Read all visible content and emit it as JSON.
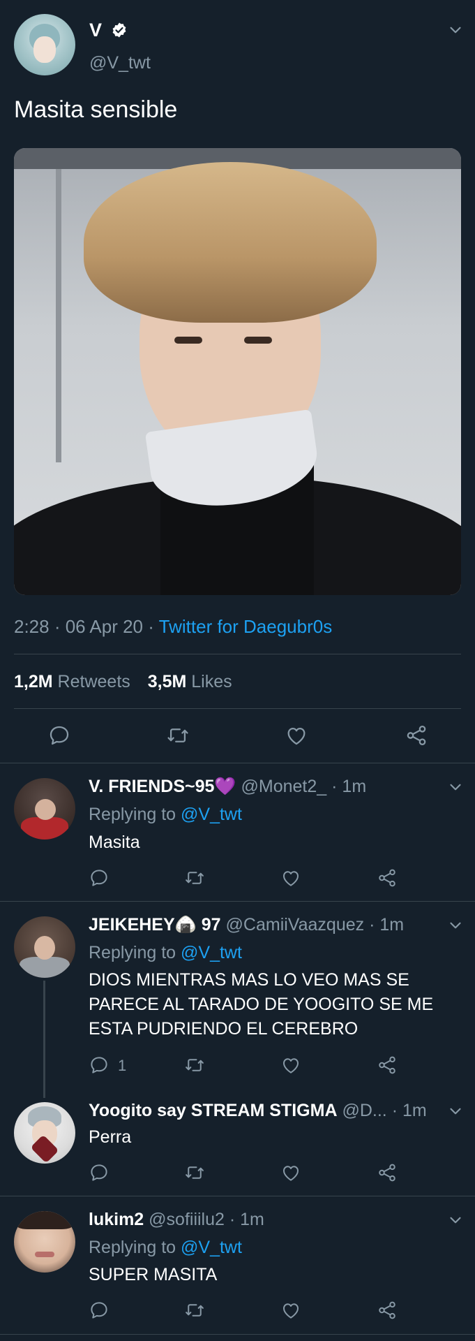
{
  "tweet": {
    "author_name": "V",
    "author_handle": "@V_twt",
    "text": "Masita sensible",
    "time": "2:28 · 06 Apr 20 · ",
    "source": "Twitter for Daegubr0s",
    "retweets_count": "1,2M",
    "retweets_label": "Retweets",
    "likes_count": "3,5M",
    "likes_label": "Likes"
  },
  "replies": [
    {
      "name": "V. FRIENDS~95",
      "emoji": "💜",
      "handle": "@Monet2_",
      "time": "· 1m",
      "replying_prefix": "Replying to ",
      "replying_to": "@V_twt",
      "text": "Masita",
      "reply_count": ""
    },
    {
      "name": "JEIKEHEY",
      "emoji": "🍙",
      "name_suffix": "97",
      "handle": "@CamiiVaazquez",
      "time": "· 1m",
      "replying_prefix": "Replying to ",
      "replying_to": "@V_twt",
      "text_lines": [
        "DIOS MIENTRAS MAS LO VEO MAS SE",
        "PARECE AL TARADO DE YOOGITO SE ME",
        "ESTA PUDRIENDO EL CEREBRO"
      ],
      "reply_count": "1"
    },
    {
      "name": "Yoogito say STREAM STIGMA",
      "handle": "@D...",
      "time": "· 1m",
      "text": "Perra",
      "reply_count": ""
    },
    {
      "name": "lukim2",
      "handle": "@sofiiilu2",
      "time": "· 1m",
      "replying_prefix": "Replying to ",
      "replying_to": "@V_twt",
      "text": "SUPER MASITA",
      "reply_count": ""
    }
  ],
  "colors": {
    "background": "#15202b",
    "muted": "#8899a6",
    "link": "#1da1f2",
    "divider": "#38444d"
  },
  "icons": [
    "chevron-down-icon",
    "verified-badge-icon",
    "reply-icon",
    "retweet-icon",
    "like-icon",
    "share-icon"
  ]
}
